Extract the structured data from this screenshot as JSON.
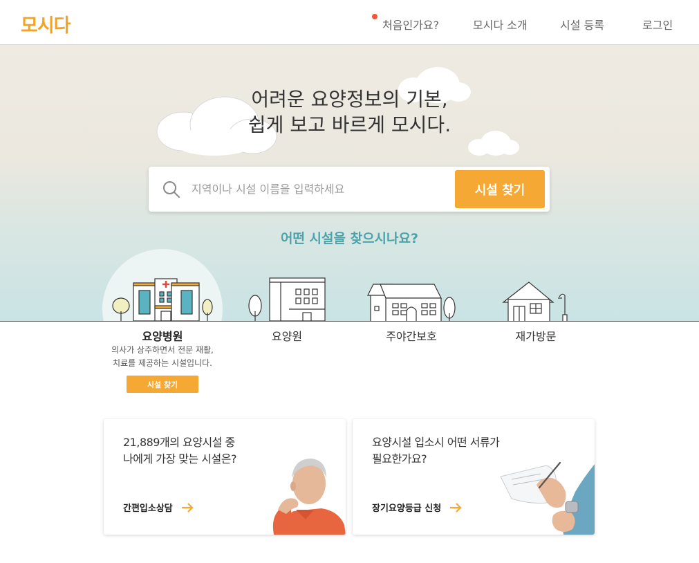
{
  "header": {
    "logo": "모시다",
    "nav": {
      "first_time": "처음인가요?",
      "about": "모시다 소개",
      "register": "시설 등록",
      "login": "로그인"
    }
  },
  "hero": {
    "title_line1": "어려운 요양정보의 기본,",
    "title_line2": "쉽게 보고 바르게 모시다.",
    "search": {
      "placeholder": "지역이나 시설 이름을 입력하세요",
      "button": "시설 찾기"
    },
    "question": "어떤 시설을 찾으시나요?"
  },
  "categories": [
    {
      "label": "요양병원",
      "active": true,
      "desc_line1": "의사가 상주하면서 전문 재활,",
      "desc_line2": "치료를 제공하는 시설입니다.",
      "button": "시설 찾기"
    },
    {
      "label": "요양원",
      "active": false
    },
    {
      "label": "주야간보호",
      "active": false
    },
    {
      "label": "재가방문",
      "active": false
    }
  ],
  "cards": [
    {
      "title_line1": "21,889개의 요양시설 중",
      "title_line2": "나에게 가장 맞는 시설은?",
      "link": "간편입소상담"
    },
    {
      "title_line1": "요양시설 입소시 어떤 서류가",
      "title_line2": "필요한가요?",
      "link": "장기요양등급 신청"
    }
  ],
  "colors": {
    "accent": "#f5a834",
    "teal": "#4aa3aa",
    "notice_dot": "#f0573b"
  }
}
